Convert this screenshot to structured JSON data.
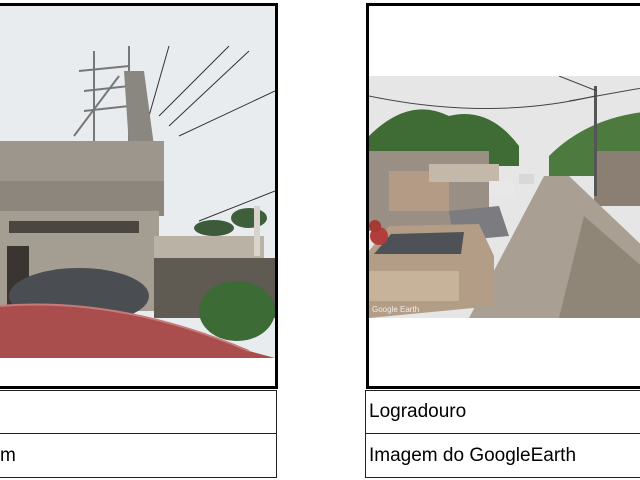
{
  "left_panel": {
    "caption_row1": "",
    "caption_row2": "m"
  },
  "right_panel": {
    "caption_row1": "Logradouro",
    "caption_row2": "Imagem do GoogleEarth",
    "watermark": "Google Earth"
  }
}
